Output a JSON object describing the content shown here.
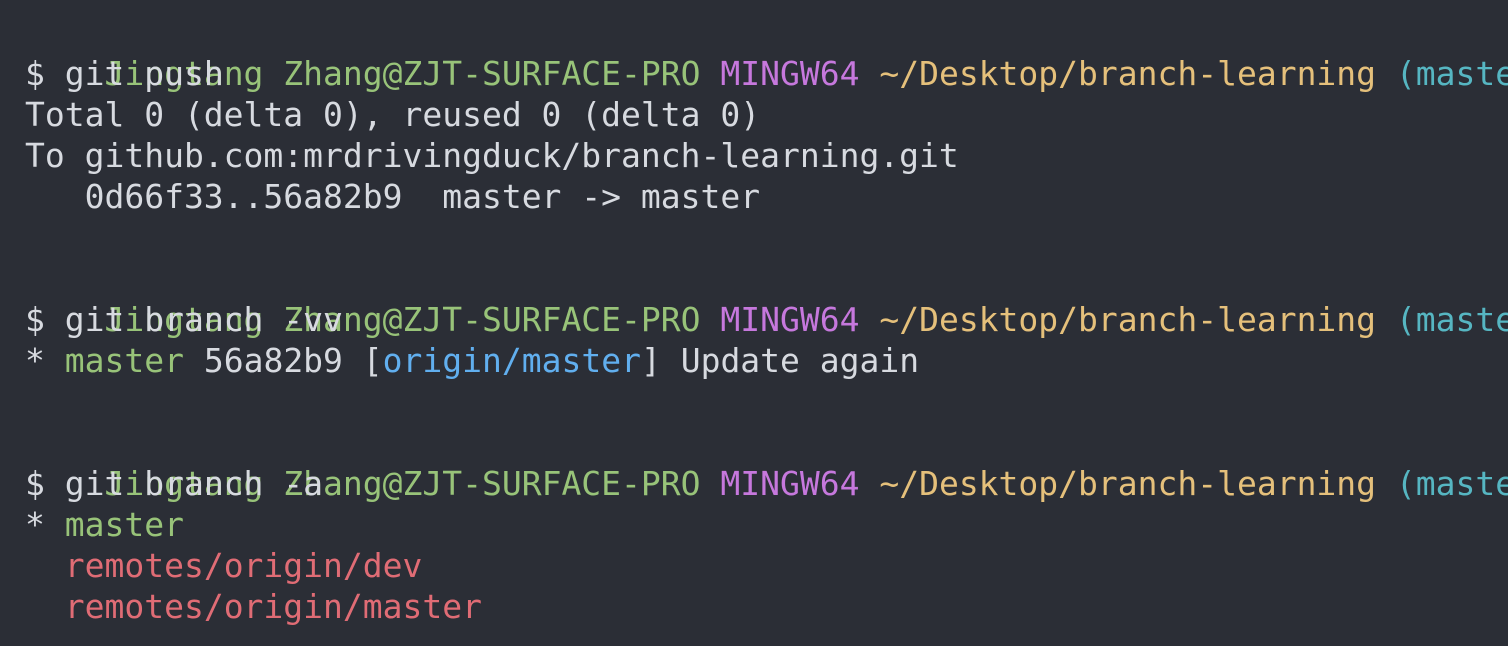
{
  "prompt": {
    "user_host": "Jingtang Zhang@ZJT-SURFACE-PRO",
    "system": "MINGW64",
    "path": "~/Desktop/branch-learning",
    "branch": "(master)",
    "symbol": "$"
  },
  "blocks": [
    {
      "command": "git push",
      "output": [
        "Total 0 (delta 0), reused 0 (delta 0)",
        "To github.com:mrdrivingduck/branch-learning.git",
        "   0d66f33..56a82b9  master -> master"
      ]
    },
    {
      "command": "git branch -vv",
      "output": {
        "marker": "*",
        "branch": "master",
        "hash": "56a82b9",
        "open_bracket": "[",
        "upstream": "origin/master",
        "close_bracket": "]",
        "message": "Update again"
      }
    },
    {
      "command": "git branch -a",
      "output": {
        "marker": "*",
        "current": "master",
        "remotes": [
          "remotes/origin/dev",
          "remotes/origin/master"
        ]
      }
    }
  ],
  "colors": {
    "background": "#2b2e36",
    "user_host": "#98c379",
    "system": "#c678dd",
    "path": "#e5c07b",
    "branch": "#56b6c2",
    "text": "#d7dae0",
    "remote_ref": "#61afef",
    "remote_branch": "#e06c75"
  }
}
